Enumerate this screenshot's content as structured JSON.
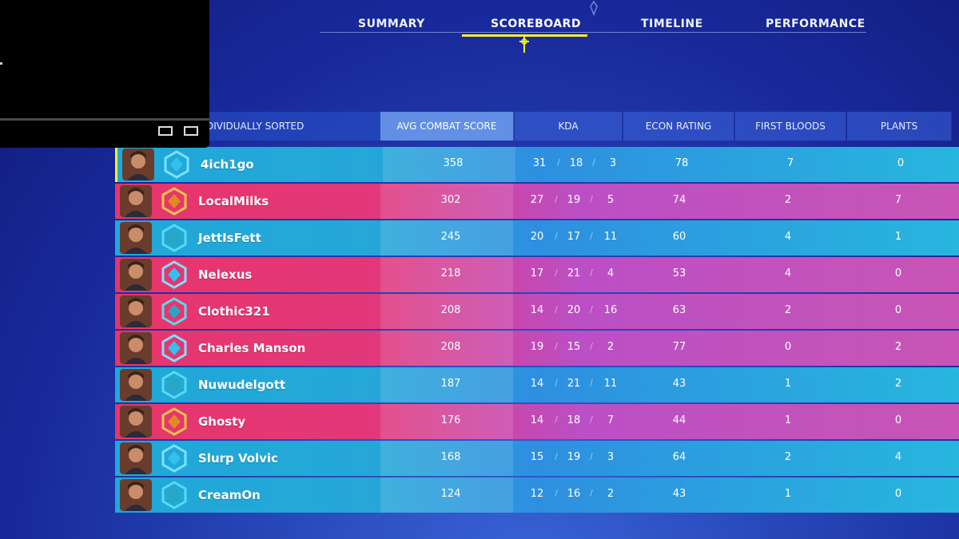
{
  "tabs": [
    {
      "label": "SUMMARY"
    },
    {
      "label": "SCOREBOARD",
      "active": true
    },
    {
      "label": "TIMELINE"
    },
    {
      "label": "PERFORMANCE"
    }
  ],
  "columns": {
    "sort_label": "DIVIDUALLY SORTED",
    "acs": "AVG COMBAT SCORE",
    "kda": "KDA",
    "econ": "ECON RATING",
    "first_bloods": "FIRST BLOODS",
    "plants": "PLANTS"
  },
  "colors": {
    "accent": "#f7f12b",
    "team_blue": "#25a7d8",
    "team_red": "#e2387a"
  },
  "players": [
    {
      "name": "4ich1go",
      "team": "blue",
      "rank_icon": "diamond-rank-icon",
      "acs": "358",
      "kills": "31",
      "deaths": "18",
      "assists": "3",
      "econ": "78",
      "first_bloods": "7",
      "plants": "0"
    },
    {
      "name": "LocalMilks",
      "team": "red",
      "rank_icon": "gold-rank-icon",
      "acs": "302",
      "kills": "27",
      "deaths": "19",
      "assists": "5",
      "econ": "74",
      "first_bloods": "2",
      "plants": "7"
    },
    {
      "name": "JettIsFett",
      "team": "blue",
      "rank_icon": "platinum-rank-icon",
      "acs": "245",
      "kills": "20",
      "deaths": "17",
      "assists": "11",
      "econ": "60",
      "first_bloods": "4",
      "plants": "1"
    },
    {
      "name": "Nelexus",
      "team": "red",
      "rank_icon": "diamond-rank-icon",
      "acs": "218",
      "kills": "17",
      "deaths": "21",
      "assists": "4",
      "econ": "53",
      "first_bloods": "4",
      "plants": "0"
    },
    {
      "name": "Clothic321",
      "team": "red",
      "rank_icon": "platinum-rank-icon",
      "acs": "208",
      "kills": "14",
      "deaths": "20",
      "assists": "16",
      "econ": "63",
      "first_bloods": "2",
      "plants": "0"
    },
    {
      "name": "Charles Manson",
      "team": "red",
      "rank_icon": "diamond-rank-icon",
      "acs": "208",
      "kills": "19",
      "deaths": "15",
      "assists": "2",
      "econ": "77",
      "first_bloods": "0",
      "plants": "2"
    },
    {
      "name": "Nuwudelgott",
      "team": "blue",
      "rank_icon": "platinum-rank-icon",
      "acs": "187",
      "kills": "14",
      "deaths": "21",
      "assists": "11",
      "econ": "43",
      "first_bloods": "1",
      "plants": "2"
    },
    {
      "name": "Ghosty",
      "team": "red",
      "rank_icon": "gold-rank-icon",
      "acs": "176",
      "kills": "14",
      "deaths": "18",
      "assists": "7",
      "econ": "44",
      "first_bloods": "1",
      "plants": "0"
    },
    {
      "name": "Slurp Volvic",
      "team": "blue",
      "rank_icon": "diamond-rank-icon",
      "acs": "168",
      "kills": "15",
      "deaths": "19",
      "assists": "3",
      "econ": "64",
      "first_bloods": "2",
      "plants": "4"
    },
    {
      "name": "CreamOn",
      "team": "blue",
      "rank_icon": "platinum-rank-icon",
      "acs": "124",
      "kills": "12",
      "deaths": "16",
      "assists": "2",
      "econ": "43",
      "first_bloods": "1",
      "plants": "0"
    }
  ]
}
